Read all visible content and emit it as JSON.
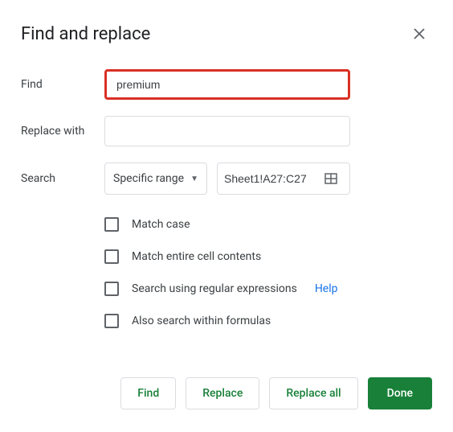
{
  "dialog": {
    "title": "Find and replace"
  },
  "fields": {
    "find_label": "Find",
    "find_value": "premium",
    "replace_label": "Replace with",
    "replace_value": "",
    "search_label": "Search",
    "scope_selected": "Specific range",
    "range_value": "Sheet1!A27:C27"
  },
  "options": {
    "match_case": "Match case",
    "match_entire": "Match entire cell contents",
    "regex": "Search using regular expressions",
    "help": "Help",
    "formulas": "Also search within formulas"
  },
  "buttons": {
    "find": "Find",
    "replace": "Replace",
    "replace_all": "Replace all",
    "done": "Done"
  }
}
